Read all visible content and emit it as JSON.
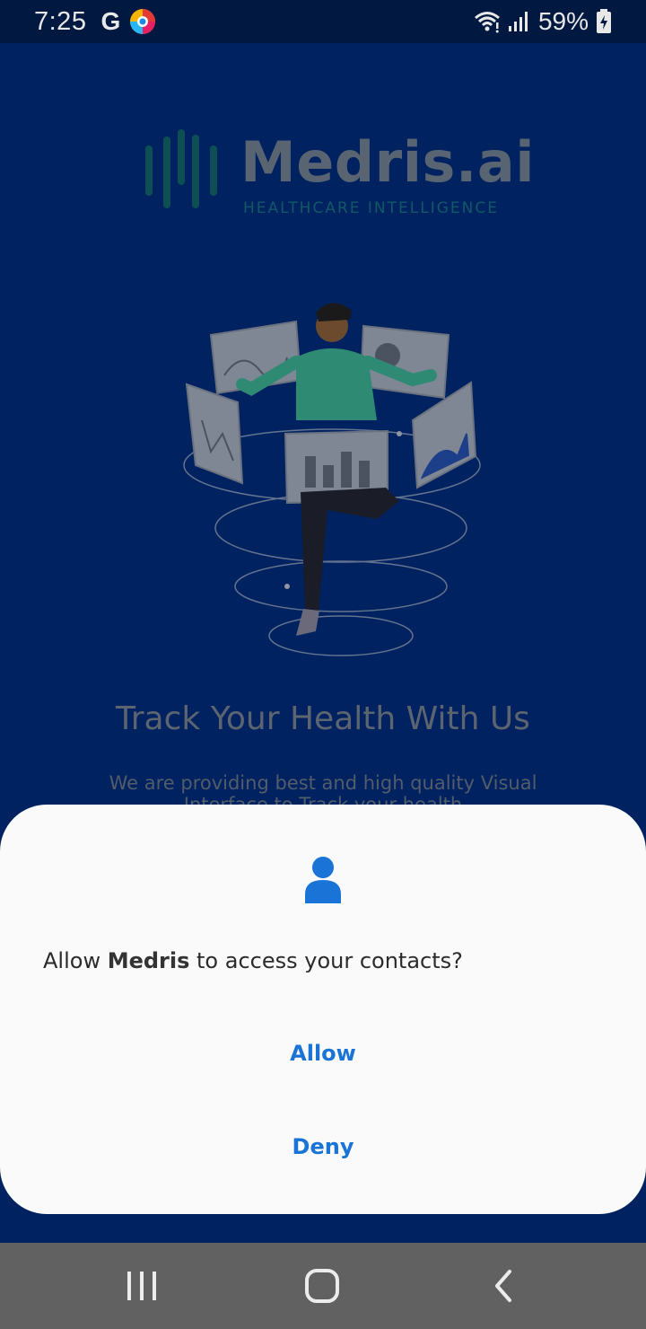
{
  "status_bar": {
    "time": "7:25",
    "g_label": "G",
    "battery_percent": "59%",
    "icons": [
      "google-icon",
      "browser-app-icon",
      "wifi-icon",
      "signal-icon",
      "battery-charging-icon"
    ]
  },
  "app": {
    "logo_name": "Medris.ai",
    "logo_tagline": "HEALTHCARE INTELLIGENCE",
    "headline": "Track Your Health With Us",
    "subtext": "We are providing best and high quality Visual Interface to Track your health"
  },
  "dialog": {
    "message_prefix": "Allow ",
    "app_name": "Medris",
    "message_suffix": " to access your contacts?",
    "allow_label": "Allow",
    "deny_label": "Deny",
    "accent_color": "#1a73d6"
  },
  "nav_bar": {
    "icons": [
      "recents-icon",
      "home-icon",
      "back-icon"
    ]
  }
}
